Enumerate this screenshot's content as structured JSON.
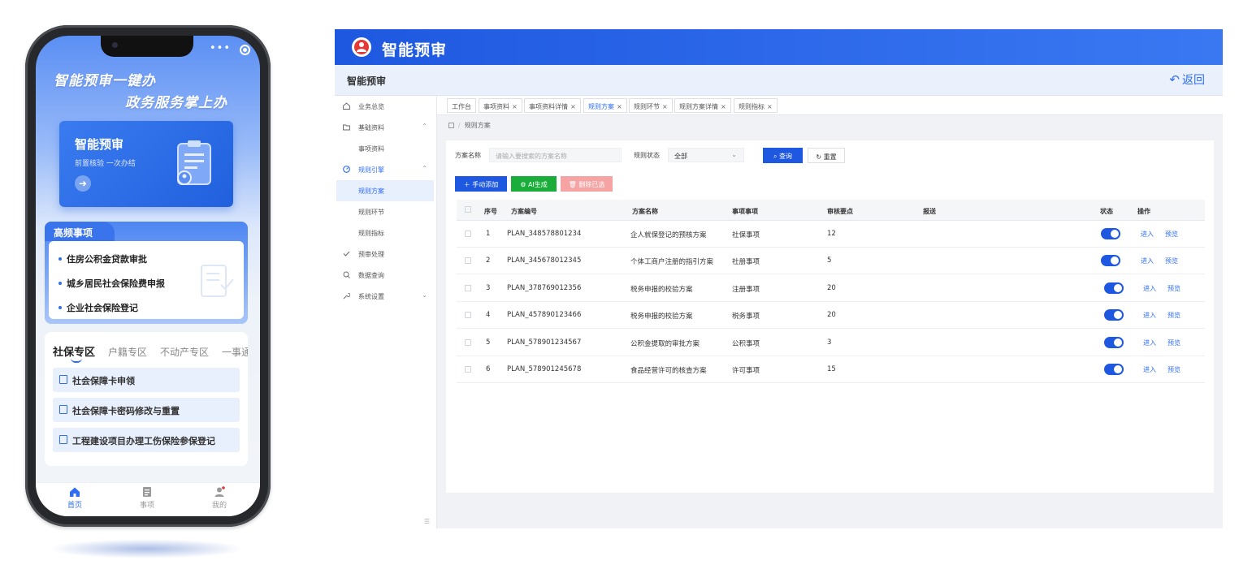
{
  "mobile": {
    "slogan_line1": "智能预审一键办",
    "slogan_line2": "政务服务掌上办",
    "hero": {
      "title": "智能预审",
      "subtitle": "前置核验  一次办结"
    },
    "frequent": {
      "title": "高频事项",
      "items": [
        "住房公积金贷款审批",
        "城乡居民社会保险费申报",
        "企业社会保险登记"
      ]
    },
    "zones": {
      "tabs": [
        "社保专区",
        "户籍专区",
        "不动产专区",
        "一事通"
      ],
      "items": [
        "社会保障卡申领",
        "社会保障卡密码修改与重置",
        "工程建设项目办理工伤保险参保登记"
      ]
    },
    "tabbar": [
      {
        "label": "首页",
        "icon": "home-icon"
      },
      {
        "label": "事项",
        "icon": "list-icon"
      },
      {
        "label": "我的",
        "icon": "user-icon"
      }
    ]
  },
  "desktop": {
    "app_title": "智能预审",
    "page_title": "智能预审",
    "back_label": "返回",
    "sidebar": [
      {
        "label": "业务总览",
        "icon": "home-icon"
      },
      {
        "label": "基础资料",
        "icon": "folder-icon",
        "chevron": "⌃"
      },
      {
        "label": "事项资料",
        "sub": true
      },
      {
        "label": "规则引擎",
        "icon": "gauge-icon",
        "chevron": "⌃"
      },
      {
        "label": "规则方案",
        "sub": true
      },
      {
        "label": "规则环节",
        "sub": true
      },
      {
        "label": "规则指标",
        "sub": true
      },
      {
        "label": "预审处理",
        "icon": "check-icon"
      },
      {
        "label": "数据查询",
        "icon": "search-icon"
      },
      {
        "label": "系统设置",
        "icon": "wrench-icon",
        "chevron": "⌄"
      }
    ],
    "tabs": [
      "工作台",
      "事项资料",
      "事项资料详情",
      "规则方案",
      "规则环节",
      "规则方案详情",
      "规则指标"
    ],
    "breadcrumb": "规则方案",
    "filters": {
      "name_label": "方案名称",
      "name_placeholder": "请输入要搜索的方案名称",
      "status_label": "规则状态",
      "status_value": "全部",
      "query_label": "查询",
      "reset_label": "重置"
    },
    "actions": {
      "add": "手动添加",
      "ai": "AI生成",
      "delete": "删除已选"
    },
    "table": {
      "headers": [
        "序号",
        "方案编号",
        "方案名称",
        "事项事项",
        "审核要点",
        "报送",
        "状态",
        "操作"
      ],
      "rows": [
        {
          "no": "1",
          "code": "PLAN_348578801234",
          "name": "企人就保登记的预核方案",
          "type": "社保事项",
          "points": "12"
        },
        {
          "no": "2",
          "code": "PLAN_345678012345",
          "name": "个体工商户注册的指引方案",
          "type": "社册事项",
          "points": "5"
        },
        {
          "no": "3",
          "code": "PLAN_378769012356",
          "name": "税务申报的校验方案",
          "type": "注册事项",
          "points": "20"
        },
        {
          "no": "4",
          "code": "PLAN_457890123466",
          "name": "税务申报的校验方案",
          "type": "税务事项",
          "points": "20"
        },
        {
          "no": "5",
          "code": "PLAN_578901234567",
          "name": "公积金提取的审批方案",
          "type": "公积事项",
          "points": "3"
        },
        {
          "no": "6",
          "code": "PLAN_578901245678",
          "name": "食品经营许可的核查方案",
          "type": "许可事项",
          "points": "15"
        }
      ],
      "enter_label": "进入",
      "preview_label": "预览"
    }
  }
}
